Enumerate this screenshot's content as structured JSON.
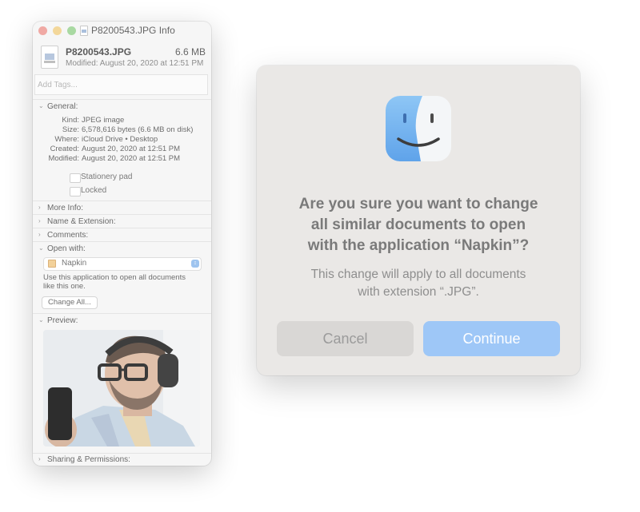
{
  "info_window": {
    "title": "P8200543.JPG Info",
    "file_name": "P8200543.JPG",
    "file_size": "6.6 MB",
    "modified": "Modified: August 20, 2020 at 12:51 PM",
    "tags_placeholder": "Add Tags...",
    "general": {
      "label": "General:",
      "rows": [
        {
          "key": "Kind:",
          "value": "JPEG image"
        },
        {
          "key": "Size:",
          "value": "6,578,616 bytes (6.6 MB on disk)"
        },
        {
          "key": "Where:",
          "value": "iCloud Drive • Desktop"
        },
        {
          "key": "Created:",
          "value": "August 20, 2020 at 12:51 PM"
        },
        {
          "key": "Modified:",
          "value": "August 20, 2020 at 12:51 PM"
        }
      ],
      "stationery_label": "Stationery pad",
      "locked_label": "Locked"
    },
    "sections": {
      "more_info": "More Info:",
      "name_extension": "Name & Extension:",
      "comments": "Comments:",
      "open_with": "Open with:",
      "preview": "Preview:",
      "sharing": "Sharing & Permissions:"
    },
    "open_with": {
      "app": "Napkin",
      "description_line1": "Use this application to open all documents",
      "description_line2": "like this one.",
      "change_all": "Change All..."
    }
  },
  "dialog": {
    "title_line1": "Are you sure you want to change",
    "title_line2": "all similar documents to open",
    "title_line3": "with the application “Napkin”?",
    "message_line1": "This change will apply to all documents",
    "message_line2": "with extension “.JPG”.",
    "cancel_label": "Cancel",
    "continue_label": "Continue"
  },
  "colors": {
    "continue_button": "#9ec7f7",
    "cancel_button": "#d9d7d5",
    "dialog_bg": "#eae8e6"
  }
}
